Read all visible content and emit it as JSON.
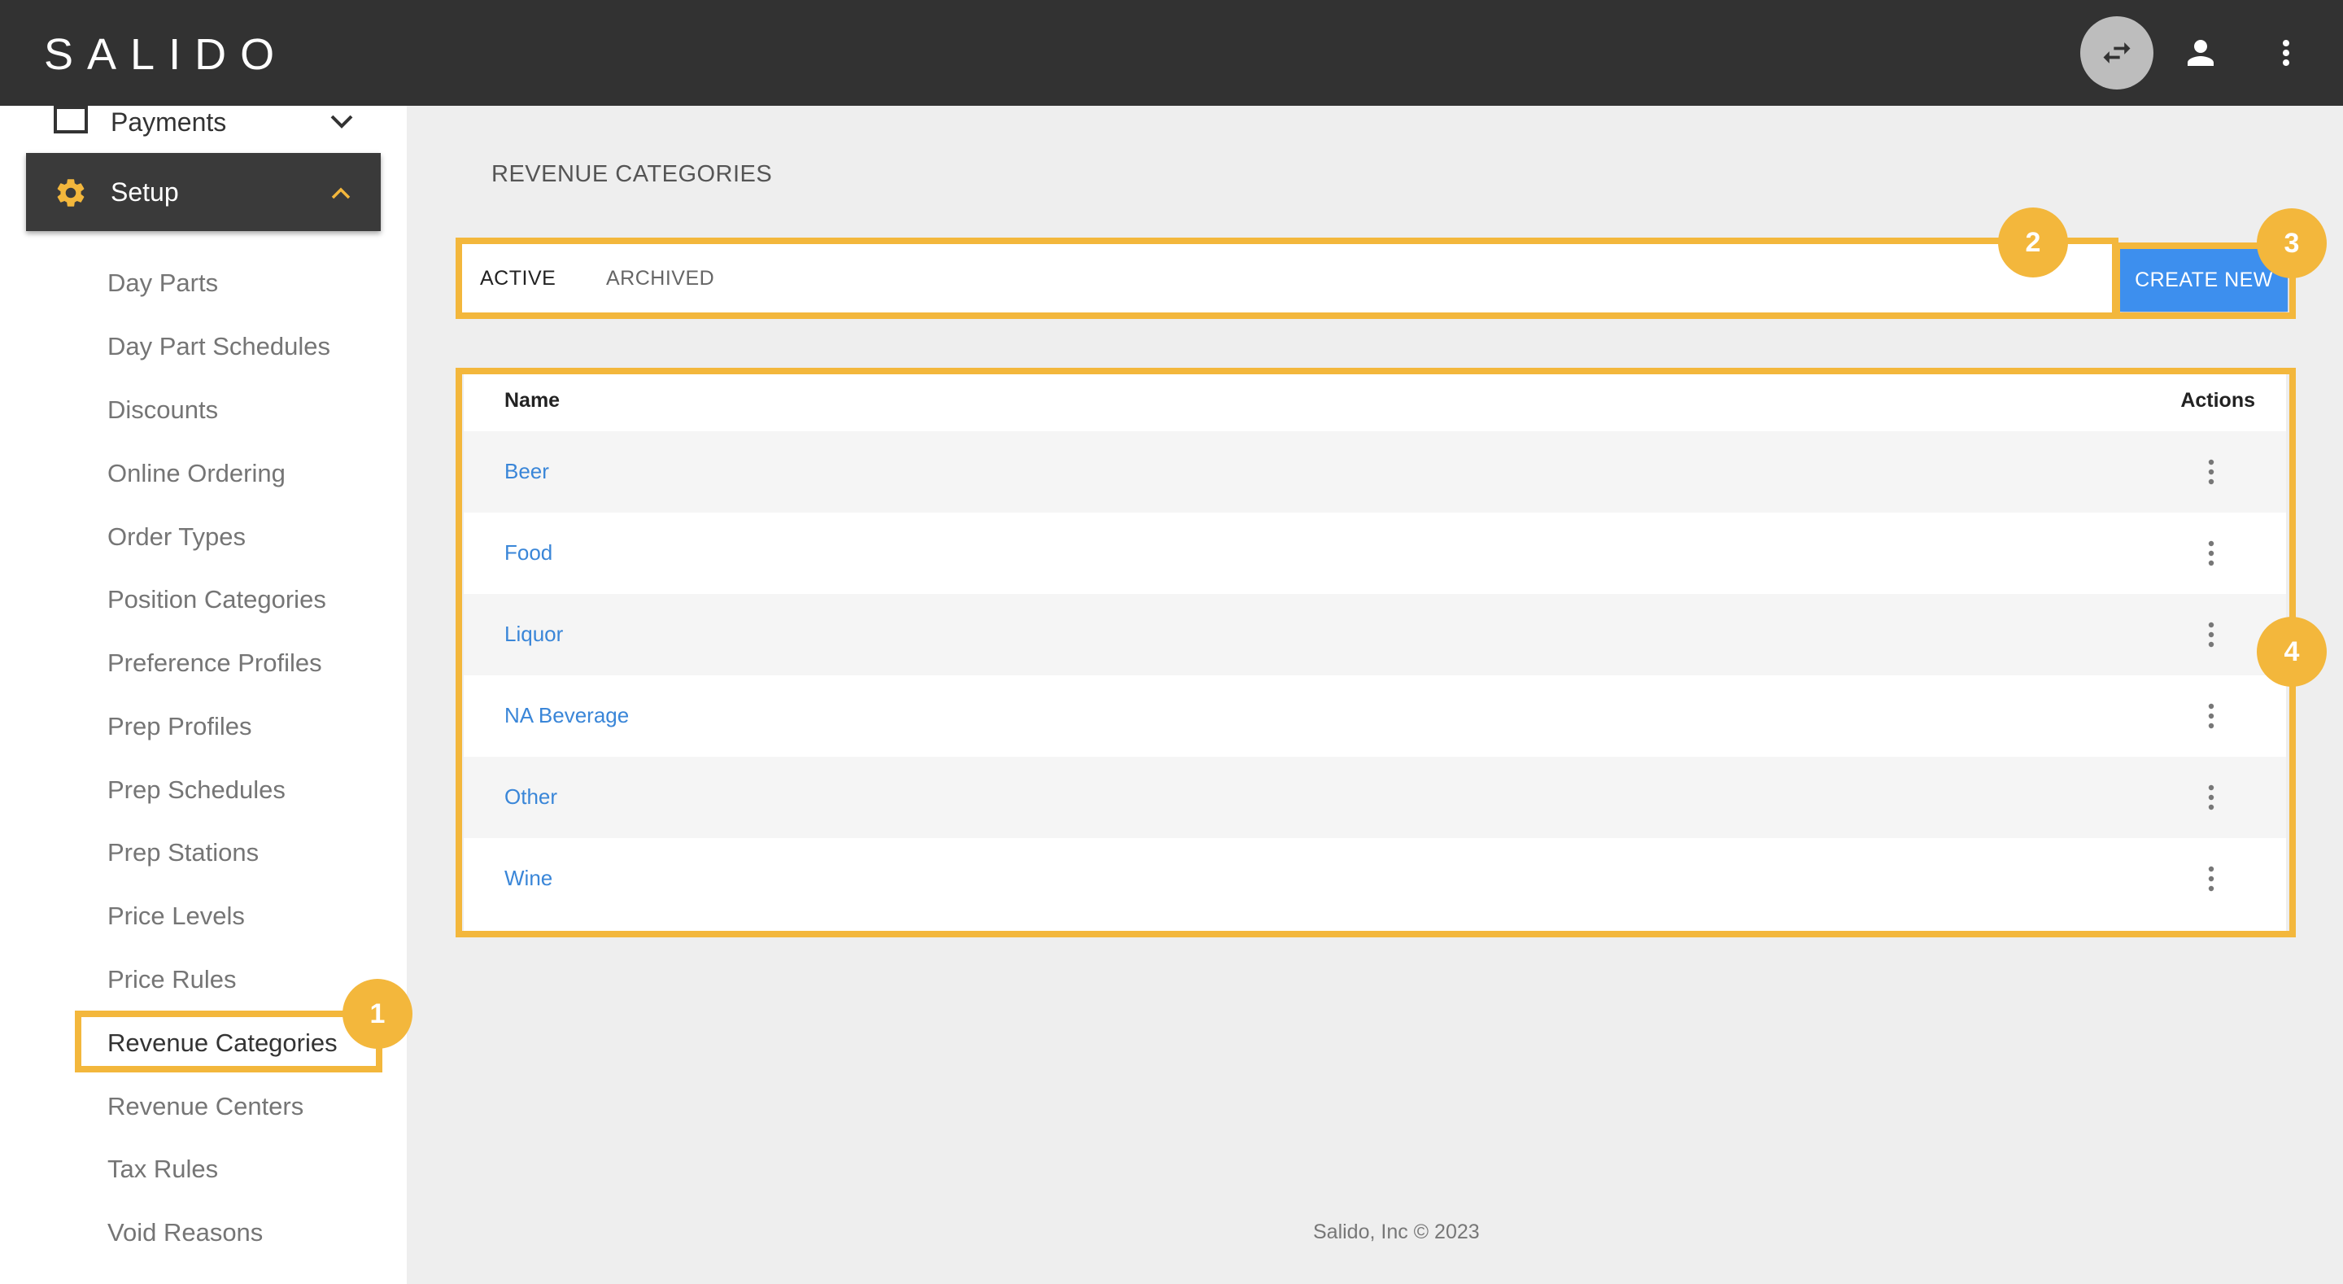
{
  "app": {
    "logo_text": "SALIDO"
  },
  "topbar": {
    "icons": {
      "swap": "swap-horiz-icon",
      "user": "account-icon",
      "more": "more-vert-icon"
    }
  },
  "sidebar": {
    "payments_label": "Payments",
    "setup_label": "Setup",
    "sub_items": [
      "Day Parts",
      "Day Part Schedules",
      "Discounts",
      "Online Ordering",
      "Order Types",
      "Position Categories",
      "Preference Profiles",
      "Prep Profiles",
      "Prep Schedules",
      "Prep Stations",
      "Price Levels",
      "Price Rules",
      "Revenue Categories",
      "Revenue Centers",
      "Tax Rules",
      "Void Reasons"
    ],
    "active_item": "Revenue Categories"
  },
  "main": {
    "title": "REVENUE CATEGORIES",
    "tabs": [
      {
        "label": "ACTIVE"
      },
      {
        "label": "ARCHIVED"
      }
    ],
    "create_label": "CREATE NEW",
    "table": {
      "headers": {
        "name": "Name",
        "actions": "Actions"
      },
      "rows": [
        "Beer",
        "Food",
        "Liquor",
        "NA Beverage",
        "Other",
        "Wine"
      ]
    }
  },
  "annotations": {
    "badge_1": "1",
    "badge_2": "2",
    "badge_3": "3",
    "badge_4": "4",
    "highlight_color": "#f3b73c"
  },
  "colors": {
    "topbar": "#323232",
    "accent": "#3d8fee",
    "link": "#3a86d8"
  },
  "footer": {
    "text": "Salido, Inc © 2023"
  }
}
